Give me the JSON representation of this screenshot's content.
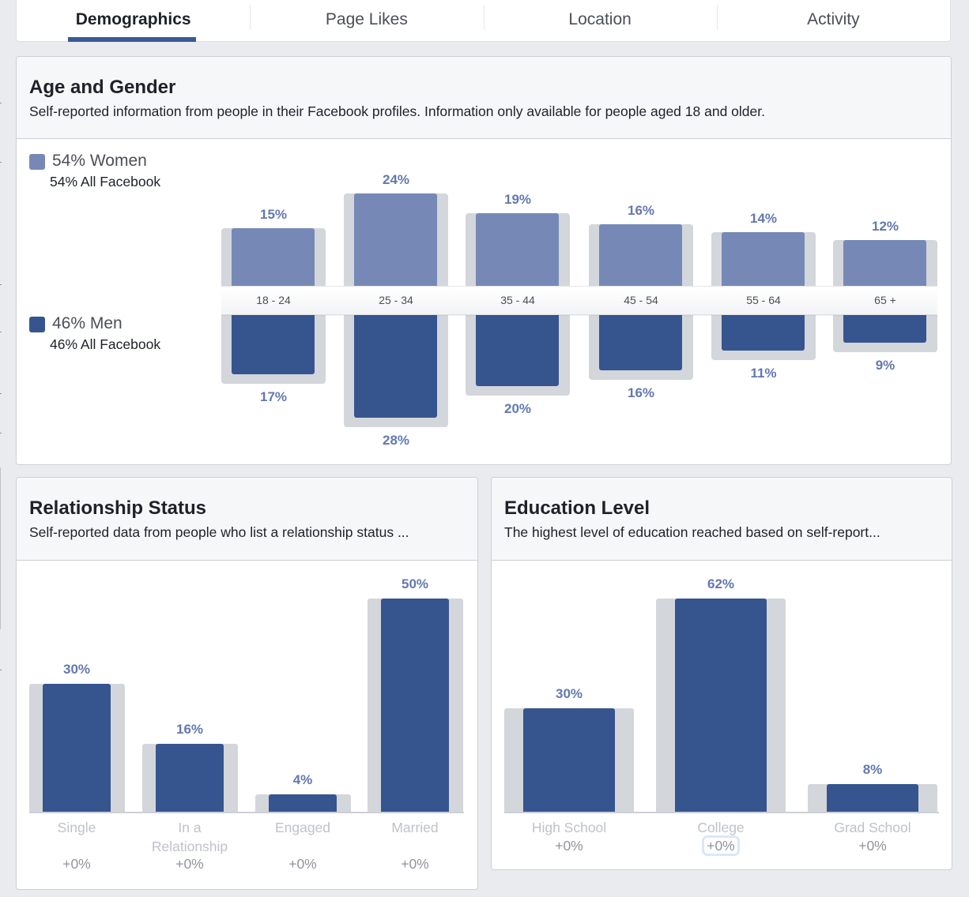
{
  "tabs": [
    {
      "label": "Demographics",
      "active": true
    },
    {
      "label": "Page Likes",
      "active": false
    },
    {
      "label": "Location",
      "active": false
    },
    {
      "label": "Activity",
      "active": false
    }
  ],
  "colors": {
    "women": "#7689b6",
    "men": "#36558f",
    "bar_background": "#d3d6db",
    "value_label": "#6278b0",
    "accent": "#3b5998"
  },
  "age_gender": {
    "title": "Age and Gender",
    "description": "Self-reported information from people in their Facebook profiles. Information only available for people aged 18 and older.",
    "legend": {
      "women": {
        "main": "54% Women",
        "sub": "54% All Facebook"
      },
      "men": {
        "main": "46% Men",
        "sub": "46% All Facebook"
      }
    }
  },
  "relationship": {
    "title": "Relationship Status",
    "description": "Self-reported data from people who list a relationship status ..."
  },
  "education": {
    "title": "Education Level",
    "description": "The highest level of education reached based on self-report..."
  },
  "chart_data": [
    {
      "type": "bar",
      "title": "Age and Gender",
      "categories": [
        "18 - 24",
        "25 - 34",
        "35 - 44",
        "45 - 54",
        "55 - 64",
        "65 +"
      ],
      "series": [
        {
          "name": "Women",
          "values": [
            15,
            24,
            19,
            16,
            14,
            12
          ],
          "labels": [
            "15%",
            "24%",
            "19%",
            "16%",
            "14%",
            "12%"
          ]
        },
        {
          "name": "Men",
          "values": [
            17,
            28,
            20,
            16,
            11,
            9
          ],
          "labels": [
            "17%",
            "28%",
            "20%",
            "16%",
            "11%",
            "9%"
          ]
        }
      ],
      "benchmark": {
        "Women": "54% All Facebook",
        "Men": "46% All Facebook"
      },
      "layout": "diverging (women above axis, men below)",
      "xlabel": "",
      "ylabel": "",
      "grid": false
    },
    {
      "type": "bar",
      "title": "Relationship Status",
      "categories": [
        "Single",
        "In a Relationship",
        "Engaged",
        "Married"
      ],
      "category_lines": [
        [
          "Single"
        ],
        [
          "In a",
          "Relationship"
        ],
        [
          "Engaged"
        ],
        [
          "Married"
        ]
      ],
      "values": [
        30,
        16,
        4,
        50
      ],
      "labels": [
        "30%",
        "16%",
        "4%",
        "50%"
      ],
      "deltas": [
        "+0%",
        "+0%",
        "+0%",
        "+0%"
      ],
      "xlabel": "",
      "ylabel": "",
      "grid": false
    },
    {
      "type": "bar",
      "title": "Education Level",
      "categories": [
        "High School",
        "College",
        "Grad School"
      ],
      "values": [
        30,
        62,
        8
      ],
      "labels": [
        "30%",
        "62%",
        "8%"
      ],
      "deltas": [
        "+0%",
        "+0%",
        "+0%"
      ],
      "focused_delta_index": 1,
      "xlabel": "",
      "ylabel": "",
      "grid": false
    }
  ]
}
